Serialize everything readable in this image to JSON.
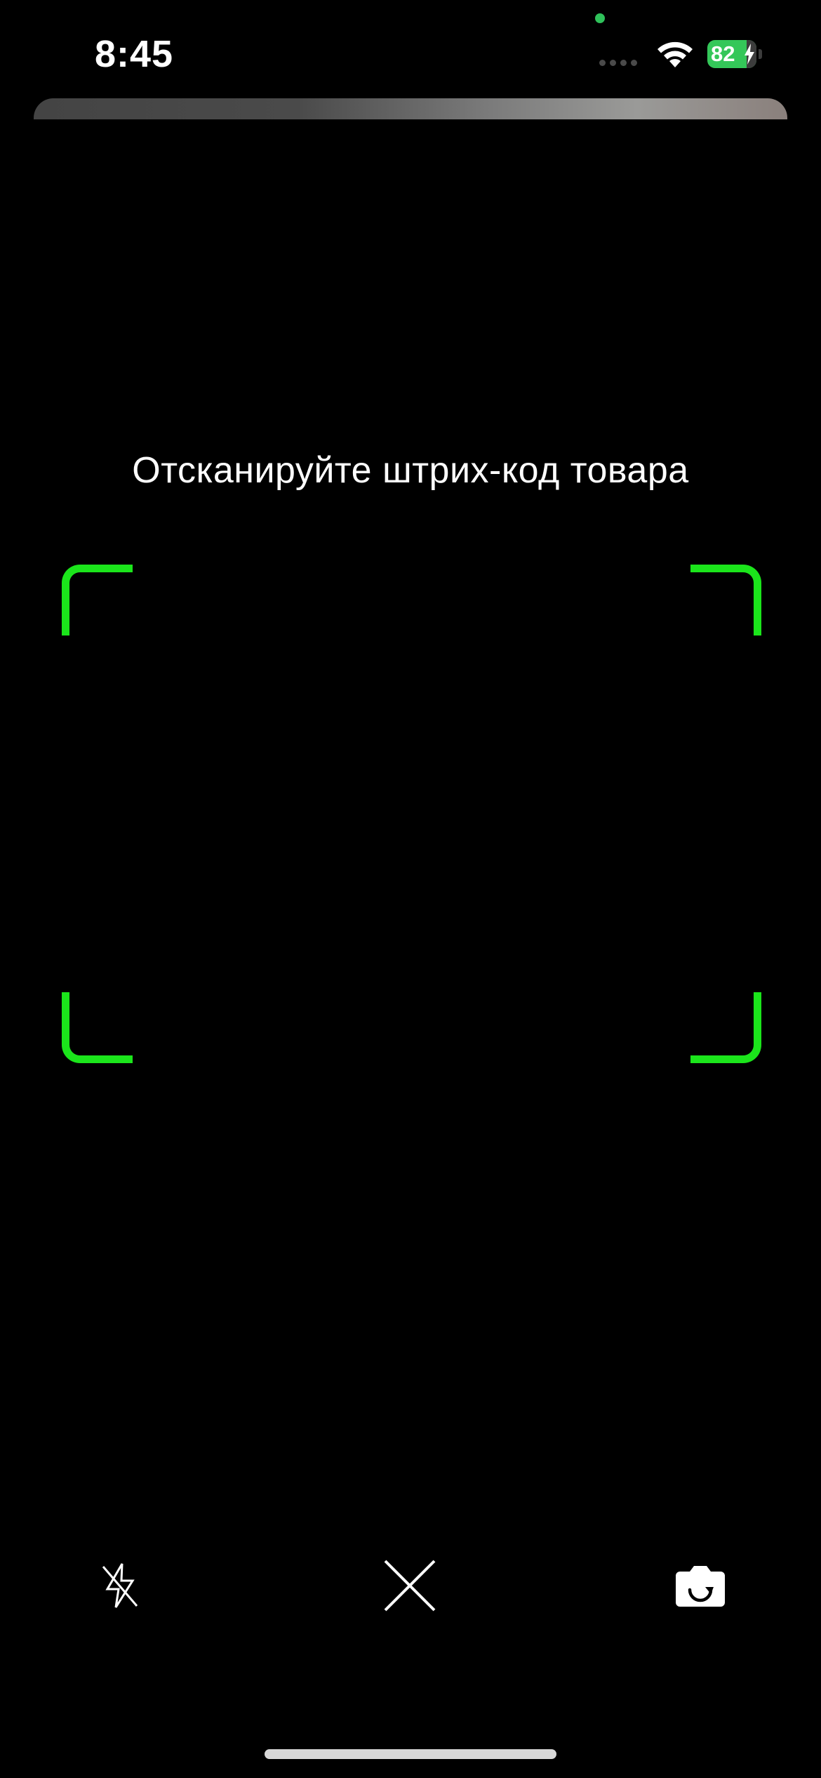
{
  "status_bar": {
    "time": "8:45",
    "battery_level": "82",
    "battery_color": "#34c759"
  },
  "scanner": {
    "instruction": "Отсканируйте штрих-код товара",
    "frame_color": "#1be51b"
  },
  "controls": {
    "flash_icon": "flash-off-icon",
    "close_icon": "close-icon",
    "camera_switch_icon": "camera-switch-icon"
  }
}
